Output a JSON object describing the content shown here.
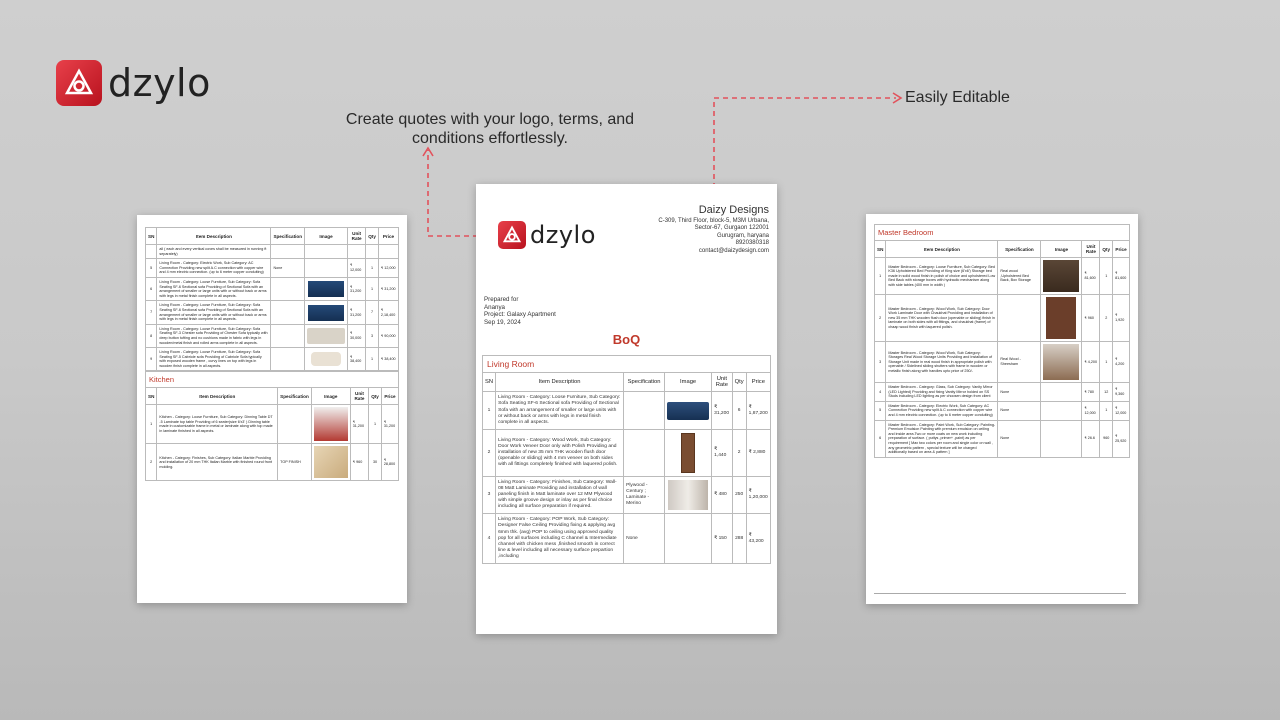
{
  "brand": {
    "name": "dzylo",
    "accent": "#c0392b"
  },
  "callouts": {
    "main": "Create quotes with your logo, terms, and conditions effortlessly.",
    "edit": "Easily Editable"
  },
  "center": {
    "company": {
      "name": "Daizy Designs",
      "lines": [
        "C-309, Third Floor, block-5, M3M Urbana,",
        "Sector-67, Gurgaon 122001",
        "Gurugram, haryana",
        "8920380318",
        "contact@daizydesign.com"
      ]
    },
    "prepared": {
      "label": "Prepared for",
      "name": "Ananya",
      "project": "Project: Galaxy Apartment",
      "date": "Sep 19, 2024"
    },
    "title": "BoQ",
    "section": "Living Room",
    "headers": [
      "SN",
      "Item Description",
      "Specification",
      "Image",
      "Unit Rate",
      "Qty",
      "Price"
    ],
    "rows": [
      {
        "sn": "1",
        "desc": "Living Room - Category: Loose Furniture, Sub Category: Sofa Seating\nSF-6 Sectional sofa\nProviding of Sectional Sofa with an arrangement of smaller or large units with or without back or arms with legs in metal finish complete in all aspects.",
        "spec": "",
        "rate": "₹ 31,200",
        "qty": "6",
        "price": "₹ 1,87,200"
      },
      {
        "sn": "2",
        "desc": "Living Room - Category: Wood Work, Sub Category: Door Work\nVeneer Door only with Polish\nProviding and installation of new 35 mm THK wooden flush door (openable or sliding) with 4 mm veneer on both sides with all fittings completely finished with laquered polish.",
        "spec": "",
        "rate": "₹ 1,440",
        "qty": "2",
        "price": "₹ 2,880"
      },
      {
        "sn": "3",
        "desc": "Living Room - Category: Finishes, Sub Category: Wall-08 Matt Laminate\nProviding and installation of wall paneling finish in Matt laminate over 12 MM Plywood with simple groove design or inlay as per final choice including all surface preparation if required.",
        "spec": "Plywood - Century ; Laminate - Merino",
        "rate": "₹ 480",
        "qty": "250",
        "price": "₹ 1,20,000"
      },
      {
        "sn": "4",
        "desc": "Living Room - Category: POP Work, Sub Category: Designer False Ceiling\nProviding fixing & applying avg 6mm thk. (avg) POP to ceiling using approved quality pop for all surfaces including C channel & Intermediate channel with chicken mess ,finished smooth in correct line & level including all necessary surface prepartion ,including",
        "spec": "None",
        "rate": "₹ 150",
        "qty": "288",
        "price": "₹ 43,200"
      }
    ]
  },
  "left": {
    "headers": [
      "SN",
      "Item Description",
      "Specification",
      "Image",
      "Unit Rate",
      "Qty",
      "Price"
    ],
    "rows": [
      {
        "sn": "",
        "desc": "all ( each and every vertical coves shall be measured in running ft separately)",
        "spec": "",
        "rate": "",
        "qty": "",
        "price": ""
      },
      {
        "sn": "5",
        "desc": "Living Room - Category: Electric Work, Sub Category: AC Connection\nProviding new split A.C connection with copper wire and 4 mm electric connection. (up to 6 meter copper conduiting)",
        "spec": "None",
        "rate": "₹ 12,000",
        "qty": "1",
        "price": "₹ 12,000"
      },
      {
        "sn": "6",
        "desc": "Living Room - Category: Loose Furniture, Sub Category: Sofa Seating\nSF-6 Sectional sofa\nProviding of Sectional Sofa with an arrangement of smaller or large units with or without back or arms with legs in metal finish complete in all aspects.",
        "spec": "",
        "rate": "₹ 31,200",
        "qty": "1",
        "price": "₹ 31,200"
      },
      {
        "sn": "7",
        "desc": "Living Room - Category: Loose Furniture, Sub Category: Sofa Seating\nSF-6 Sectional sofa\nProviding of Sectional Sofa with an arrangement of smaller or large units with or without back or arms with legs in metal finish complete in all aspects.",
        "spec": "",
        "rate": "₹ 31,200",
        "qty": "7",
        "price": "₹ 2,18,400"
      },
      {
        "sn": "8",
        "desc": "Living Room - Category: Loose Furniture, Sub Category: Sofa Seating\nSF-3 Chester sofa\nProviding of Chester Sofa typically with deep button tufting and no cushions made in fabric with legs in wooden/metal finish and rolled arms complete in all aspects.",
        "spec": "",
        "rate": "₹ 30,000",
        "qty": "3",
        "price": "₹ 90,000"
      },
      {
        "sn": "9",
        "desc": "Living Room - Category: Loose Furniture, Sub Category: Sofa Seating\nSF-5 Cabriole sofa\nProviding of Cabriole Sofa typically with exposed wooden frame , curvy lines on top with legs in wooden finish complete in all aspects.",
        "spec": "",
        "rate": "₹ 38,400",
        "qty": "1",
        "price": "₹ 38,400"
      }
    ],
    "section2": "Kitchen",
    "rows2": [
      {
        "sn": "1",
        "desc": "Kitchen - Category: Loose Furniture, Sub Category: Dinning Table\nDT -5 Laminate top table\nProviding of 6 seater(size 6'x3' ) Dinning table made in customizable frame in metal or laminate along with top made in laminate finished in all aspects.",
        "spec": "",
        "rate": "₹ 31,200",
        "qty": "1",
        "price": "₹ 31,200"
      },
      {
        "sn": "2",
        "desc": "Kitchen - Category: Finishes, Sub Category: Italian Marble\nProviding and installation of 20 mm THK Italian Marble with finished round front molding.",
        "spec": "TOP FINISH",
        "rate": "₹ 960",
        "qty": "30",
        "price": "₹ 28,800"
      }
    ]
  },
  "right": {
    "section": "Master Bedroom",
    "headers": [
      "SN",
      "Item Description",
      "Specification",
      "Image",
      "Unit Rate",
      "Qty",
      "Price"
    ],
    "rows": [
      {
        "sn": "1",
        "desc": "Master Bedroom - Category: Loose Furniture, Sub Category: Bed\nK36 Upholstered Bed\nProviding of King size (6'x6') Storage bed made in solid wood finish in polish of choice and upholstered Low Bed Back with storage boxes with hydraulic mechanism along with side tables (400 mm in width )",
        "spec": "Real wood ,Upholstered Bed Back, Box Storage",
        "rate": "₹ 81,600",
        "qty": "1",
        "price": "₹ 81,600"
      },
      {
        "sn": "2",
        "desc": "Master Bedroom - Category: Wood Work, Sub Category: Door Work\nLaminate Door with Chaukhat\nProviding and installation of new 35 mm THK wooden flush door (openable or sliding) finish in laminate on both sides with all fittings, and chaukhat (frame) of chaap wood finish with laquered polish.",
        "spec": "",
        "rate": "₹ 960",
        "qty": "2",
        "price": "₹ 1,920"
      },
      {
        "sn": "3",
        "desc": "Master Bedroom - Category: Wood Work, Sub Category: Storages\nReal Wood Storage Units\nProviding and Installation of Storage Unit made in real wood finish in appropriate polish with openable / Sidelined sliding shutters with frame in wooden or metallic finish along with handles upto price of 250/-",
        "spec": "Real Wood - Sheesham",
        "rate": "₹ 4,200",
        "qty": "1",
        "price": "₹ 4,200"
      },
      {
        "sn": "4",
        "desc": "Master Bedroom - Category: Glass, Sub Category: Vanity Mirror (LED Lighted)\nProviding and fixing Vanity Mirror holded on SS Studs including LED lighting as per choosen design from client",
        "spec": "None",
        "rate": "₹ 780",
        "qty": "12",
        "price": "₹ 9,360"
      },
      {
        "sn": "5",
        "desc": "Master Bedroom - Category: Electric Work, Sub Category:\nAC Connection\nProviding new split A.C connection with copper wire and 4 mm electric connection. (up to 6 meter copper conduiting)",
        "spec": "None",
        "rate": "₹ 12,000",
        "qty": "1",
        "price": "₹ 12,000"
      },
      {
        "sn": "6",
        "desc": "Master Bedroom - Category: Paint Work, Sub Category:\nPainting-Premium Emulsion\nPainting with premium emulsion on ceiling and inside area.Two or more coats on new work including preparation of surface. ( puttys ,primer+ ,paint) as per\n requirement [ Max two colors per room and single color on wall , any geometric pattern , special texture will be charged additionally based on area & pattern ]",
        "spec": "None",
        "rate": "₹ 26.6",
        "qty": "960",
        "price": "₹ 25,920"
      }
    ]
  }
}
